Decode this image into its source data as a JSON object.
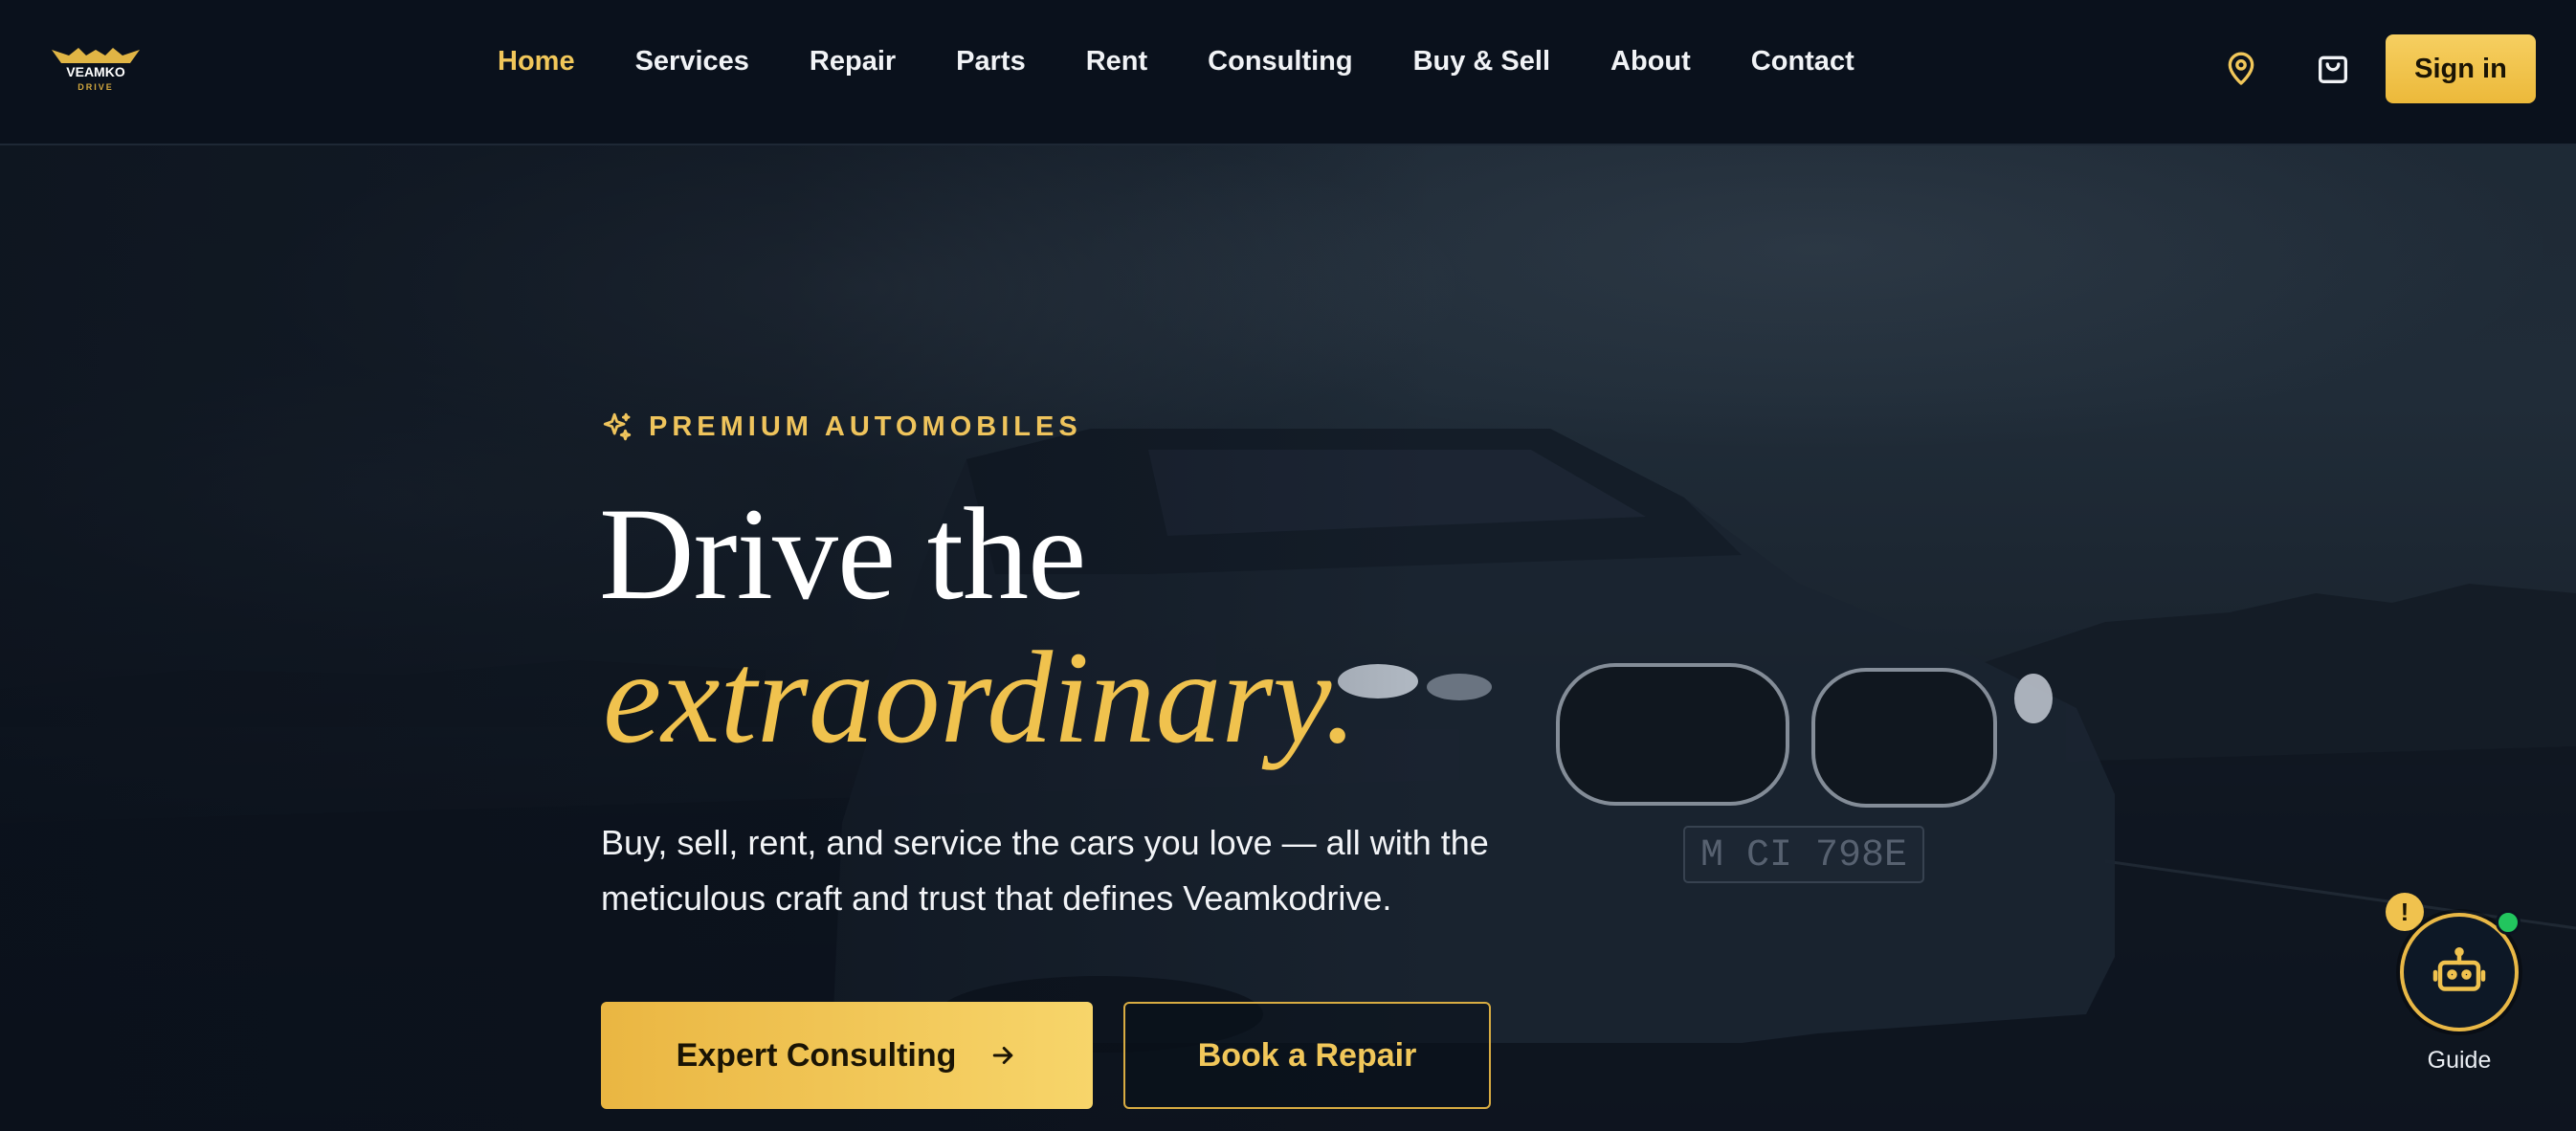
{
  "brand": {
    "logo_text_top": "VEAMKO",
    "logo_text_bottom": "DRIVE"
  },
  "nav": {
    "links": [
      {
        "label": "Home",
        "active": true
      },
      {
        "label": "Services",
        "active": false
      },
      {
        "label": "Repair",
        "active": false
      },
      {
        "label": "Parts",
        "active": false
      },
      {
        "label": "Rent",
        "active": false
      },
      {
        "label": "Consulting",
        "active": false
      },
      {
        "label": "Buy & Sell",
        "active": false
      },
      {
        "label": "About",
        "active": false
      },
      {
        "label": "Contact",
        "active": false
      }
    ],
    "location_icon": "map-pin-icon",
    "cart_icon": "shopping-bag-icon",
    "signin_label": "Sign in"
  },
  "hero": {
    "eyebrow_icon": "sparkles-icon",
    "eyebrow": "PREMIUM AUTOMOBILES",
    "headline_line1": "Drive the",
    "headline_line2": "extraordinary.",
    "subtitle": "Buy, sell, rent, and service the cars you love — all with the meticulous craft and trust that defines Veamkodrive.",
    "primary_cta": "Expert Consulting",
    "primary_cta_icon": "arrow-right-icon",
    "secondary_cta": "Book a Repair",
    "plate_text": "M CI 798E"
  },
  "guide": {
    "label": "Guide",
    "alert": "!",
    "icon": "robot-icon",
    "status": "online"
  },
  "colors": {
    "accent": "#f1c75a",
    "nav_bg": "#0a111c",
    "online": "#22c55e"
  }
}
